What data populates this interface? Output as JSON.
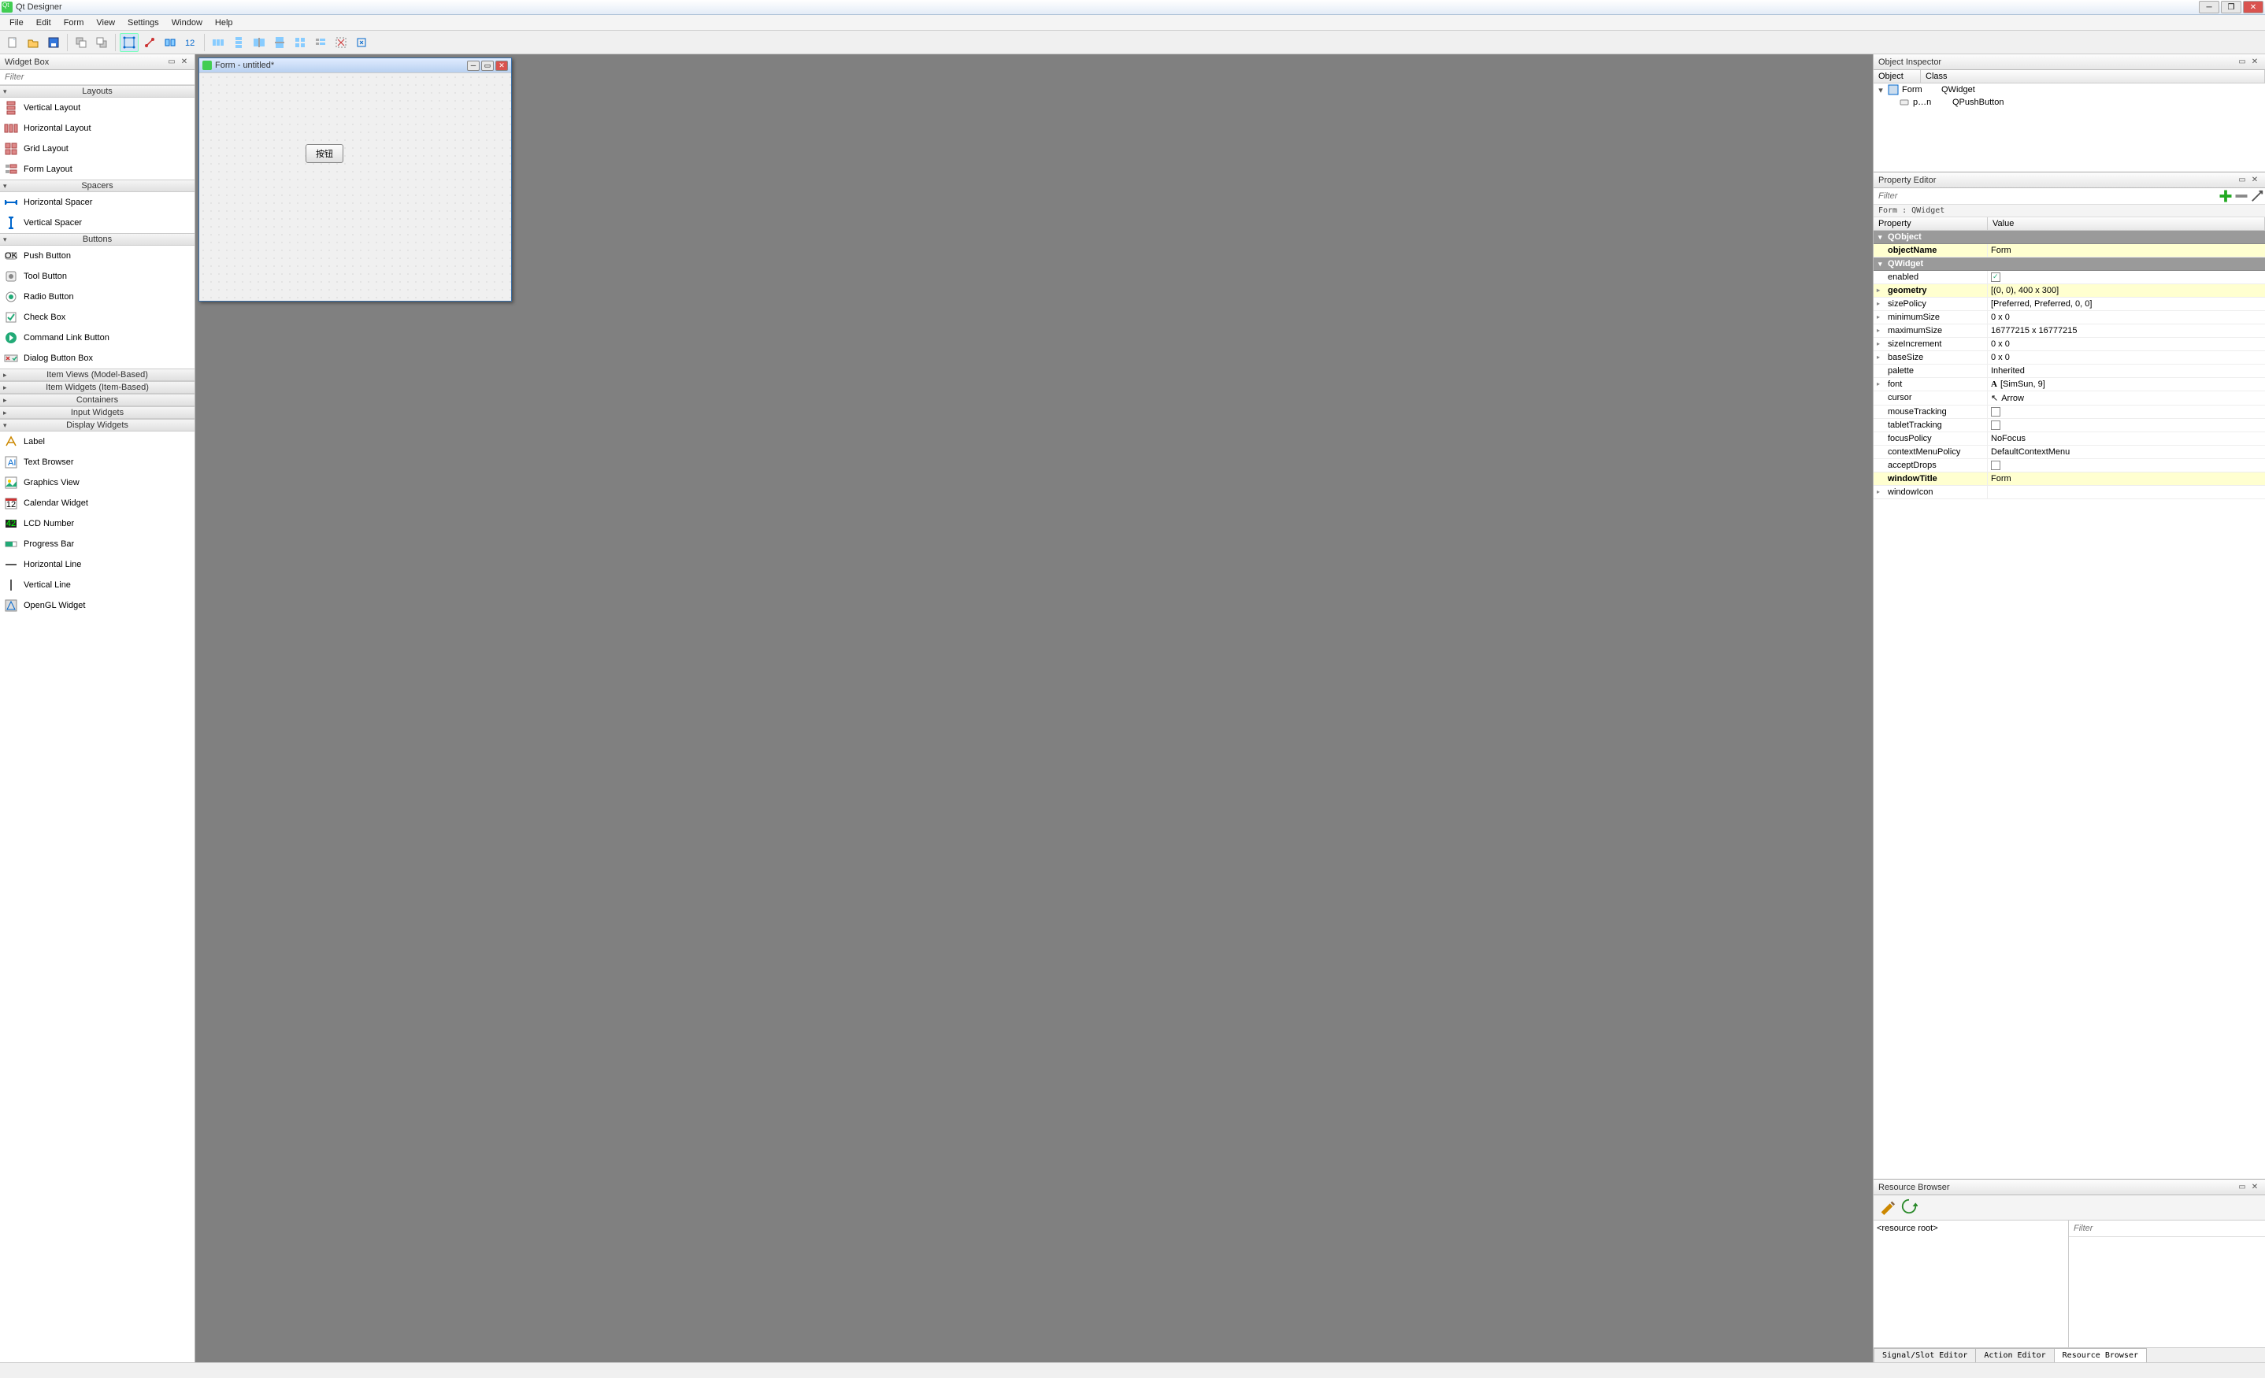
{
  "app_title": "Qt Designer",
  "menus": [
    "File",
    "Edit",
    "Form",
    "View",
    "Settings",
    "Window",
    "Help"
  ],
  "toolbar_icons": [
    {
      "name": "new-file-icon"
    },
    {
      "name": "open-file-icon"
    },
    {
      "name": "save-file-icon"
    },
    {
      "sep": true
    },
    {
      "name": "send-back-icon"
    },
    {
      "name": "bring-front-icon"
    },
    {
      "sep": true
    },
    {
      "name": "edit-widgets-icon",
      "active": true
    },
    {
      "name": "edit-signals-icon"
    },
    {
      "name": "edit-buddies-icon"
    },
    {
      "name": "edit-tab-order-icon"
    },
    {
      "sep": true
    },
    {
      "name": "layout-h-icon"
    },
    {
      "name": "layout-v-icon"
    },
    {
      "name": "layout-h-splitter-icon"
    },
    {
      "name": "layout-v-splitter-icon"
    },
    {
      "name": "layout-grid-icon"
    },
    {
      "name": "layout-form-icon"
    },
    {
      "name": "break-layout-icon"
    },
    {
      "name": "adjust-size-icon"
    }
  ],
  "widget_box": {
    "title": "Widget Box",
    "filter_placeholder": "Filter",
    "categories": [
      {
        "name": "Layouts",
        "items": [
          {
            "label": "Vertical Layout",
            "icon": "layout-v"
          },
          {
            "label": "Horizontal Layout",
            "icon": "layout-h"
          },
          {
            "label": "Grid Layout",
            "icon": "layout-grid"
          },
          {
            "label": "Form Layout",
            "icon": "layout-form"
          }
        ]
      },
      {
        "name": "Spacers",
        "items": [
          {
            "label": "Horizontal Spacer",
            "icon": "spacer-h"
          },
          {
            "label": "Vertical Spacer",
            "icon": "spacer-v"
          }
        ]
      },
      {
        "name": "Buttons",
        "items": [
          {
            "label": "Push Button",
            "icon": "push-btn"
          },
          {
            "label": "Tool Button",
            "icon": "tool-btn"
          },
          {
            "label": "Radio Button",
            "icon": "radio-btn"
          },
          {
            "label": "Check Box",
            "icon": "check-box"
          },
          {
            "label": "Command Link Button",
            "icon": "cmd-link"
          },
          {
            "label": "Dialog Button Box",
            "icon": "dlg-box"
          }
        ]
      },
      {
        "name": "Item Views (Model-Based)",
        "collapsed": true,
        "items": []
      },
      {
        "name": "Item Widgets (Item-Based)",
        "collapsed": true,
        "items": []
      },
      {
        "name": "Containers",
        "collapsed": true,
        "items": []
      },
      {
        "name": "Input Widgets",
        "collapsed": true,
        "items": []
      },
      {
        "name": "Display Widgets",
        "items": [
          {
            "label": "Label",
            "icon": "label"
          },
          {
            "label": "Text Browser",
            "icon": "text-browser"
          },
          {
            "label": "Graphics View",
            "icon": "graphics-view"
          },
          {
            "label": "Calendar Widget",
            "icon": "calendar"
          },
          {
            "label": "LCD Number",
            "icon": "lcd"
          },
          {
            "label": "Progress Bar",
            "icon": "progress"
          },
          {
            "label": "Horizontal Line",
            "icon": "hline"
          },
          {
            "label": "Vertical Line",
            "icon": "vline"
          },
          {
            "label": "OpenGL Widget",
            "icon": "opengl"
          }
        ]
      }
    ]
  },
  "form": {
    "window_title": "Form - untitled*",
    "button_label": "按钮"
  },
  "object_inspector": {
    "title": "Object Inspector",
    "headers": [
      "Object",
      "Class"
    ],
    "rows": [
      {
        "indent": 0,
        "exp": "▾",
        "obj": "Form",
        "cls": "QWidget",
        "icon": "form"
      },
      {
        "indent": 1,
        "exp": "",
        "obj": "p…n",
        "cls": "QPushButton",
        "icon": "button"
      }
    ]
  },
  "property_editor": {
    "title": "Property Editor",
    "filter_placeholder": "Filter",
    "crumb": "Form : QWidget",
    "headers": [
      "Property",
      "Value"
    ],
    "groups": [
      {
        "name": "QObject",
        "rows": [
          {
            "prop": "objectName",
            "val": "Form",
            "bold": true,
            "changed": true
          }
        ]
      },
      {
        "name": "QWidget",
        "rows": [
          {
            "prop": "enabled",
            "type": "check",
            "checked": true
          },
          {
            "prop": "geometry",
            "val": "[(0, 0), 400 x 300]",
            "bold": true,
            "exp": true,
            "changed": true
          },
          {
            "prop": "sizePolicy",
            "val": "[Preferred, Preferred, 0, 0]",
            "exp": true
          },
          {
            "prop": "minimumSize",
            "val": "0 x 0",
            "exp": true
          },
          {
            "prop": "maximumSize",
            "val": "16777215 x 16777215",
            "exp": true
          },
          {
            "prop": "sizeIncrement",
            "val": "0 x 0",
            "exp": true
          },
          {
            "prop": "baseSize",
            "val": "0 x 0",
            "exp": true
          },
          {
            "prop": "palette",
            "val": "Inherited"
          },
          {
            "prop": "font",
            "val": "[SimSun, 9]",
            "exp": true,
            "icon": "font"
          },
          {
            "prop": "cursor",
            "val": "Arrow",
            "icon": "cursor"
          },
          {
            "prop": "mouseTracking",
            "type": "check",
            "checked": false
          },
          {
            "prop": "tabletTracking",
            "type": "check",
            "checked": false
          },
          {
            "prop": "focusPolicy",
            "val": "NoFocus"
          },
          {
            "prop": "contextMenuPolicy",
            "val": "DefaultContextMenu"
          },
          {
            "prop": "acceptDrops",
            "type": "check",
            "checked": false
          },
          {
            "prop": "windowTitle",
            "val": "Form",
            "bold": true,
            "changed": true
          },
          {
            "prop": "windowIcon",
            "val": "",
            "exp": true
          }
        ]
      }
    ]
  },
  "resource_browser": {
    "title": "Resource Browser",
    "filter_placeholder": "Filter",
    "root_label": "<resource root>",
    "tabs": [
      "Signal/Slot Editor",
      "Action Editor",
      "Resource Browser"
    ],
    "active_tab": 2
  }
}
